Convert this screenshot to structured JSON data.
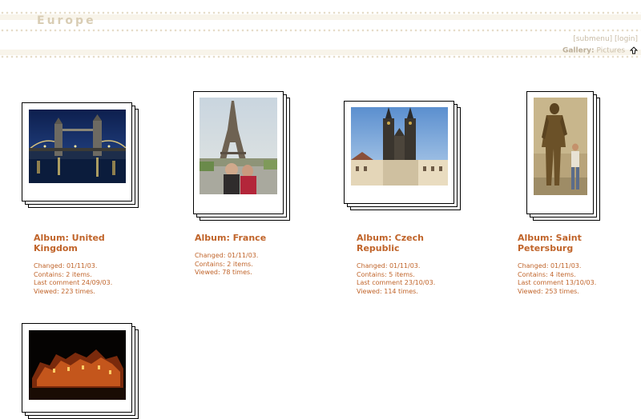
{
  "header": {
    "title": "Europe",
    "links": {
      "register": "[submenu]",
      "login": "[login]"
    },
    "gallery_label": "Gallery:",
    "gallery_value": "Pictures"
  },
  "albums": [
    {
      "title": "Album: United Kingdom",
      "changed": "Changed: 01/11/03.",
      "contains": "Contains: 2 items.",
      "last_comment": "Last comment 24/09/03.",
      "viewed": "Viewed: 223 times."
    },
    {
      "title": "Album: France",
      "changed": "Changed: 01/11/03.",
      "contains": "Contains: 2 items.",
      "last_comment": "",
      "viewed": "Viewed: 78 times."
    },
    {
      "title": "Album: Czech Republic",
      "changed": "Changed: 01/11/03.",
      "contains": "Contains: 5 items.",
      "last_comment": "Last comment 23/10/03.",
      "viewed": "Viewed: 114 times."
    },
    {
      "title": "Album: Saint Petersburg",
      "changed": "Changed: 01/11/03.",
      "contains": "Contains: 4 items.",
      "last_comment": "Last comment 13/10/03.",
      "viewed": "Viewed: 253 times."
    }
  ],
  "colors": {
    "accent": "#c0642a",
    "header_text": "#d9cdb4",
    "link": "#c9bca6"
  }
}
